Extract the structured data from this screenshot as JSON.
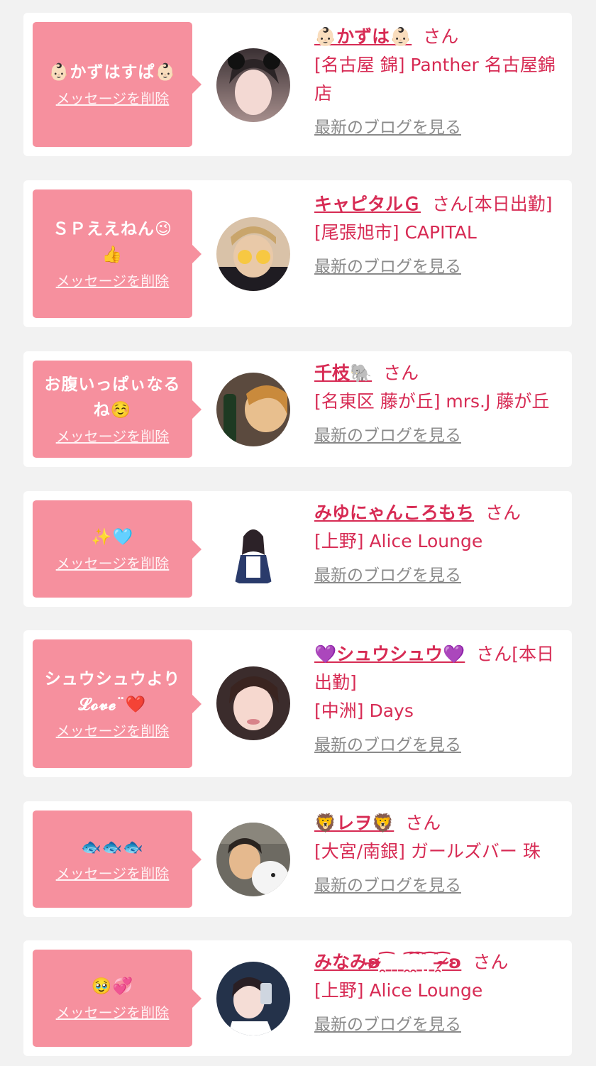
{
  "messages": [
    {
      "message": "👶🏻かずはすぱ👶🏻",
      "delete_label": "メッセージを削除",
      "name": "👶🏻かずは👶🏻",
      "suffix": "さん",
      "location": "[名古屋 錦] Panther 名古屋錦店",
      "blog_label": "最新のブログを見る"
    },
    {
      "message": "ＳＰええねん😉👍",
      "delete_label": "メッセージを削除",
      "name": "キャピタルＧ",
      "suffix": "さん[本日出勤]",
      "location": "[尾張旭市] CAPITAL",
      "blog_label": "最新のブログを見る"
    },
    {
      "message": "お腹いっぱぃなるね☺️",
      "delete_label": "メッセージを削除",
      "name": "千枝🐘",
      "suffix": "さん",
      "location": "[名東区 藤が丘] mrs.J 藤が丘",
      "blog_label": "最新のブログを見る"
    },
    {
      "message": "✨🩵",
      "delete_label": "メッセージを削除",
      "name": "みゆにゃんころもち",
      "suffix": "さん",
      "location": "[上野] Alice Lounge",
      "blog_label": "最新のブログを見る"
    },
    {
      "message": "シュウシュウより𝓛𝓸𝓿𝓮¨❤️",
      "delete_label": "メッセージを削除",
      "name": "💜シュウシュウ💜",
      "suffix": "さん[本日出勤]",
      "location": "[中洲] Days",
      "blog_label": "最新のブログを見る"
    },
    {
      "message": "🐟🐟🐟",
      "delete_label": "メッセージを削除",
      "name": "🦁レヲ🦁",
      "suffix": "さん",
      "location": "[大宮/南銀] ガールズバー 珠",
      "blog_label": "最新のブログを見る"
    },
    {
      "message": "🥹💞",
      "delete_label": "メッセージを削除",
      "name": "みなみʚ̴̶̷̷ ̯͡ ̱ ̱  ̱ ̯͡ ̯͡ ̱ ͡ ̱ ̯͡ ̷̶̴̷ʚ",
      "suffix": "さん",
      "location": "[上野] Alice Lounge",
      "blog_label": "最新のブログを見る"
    }
  ]
}
